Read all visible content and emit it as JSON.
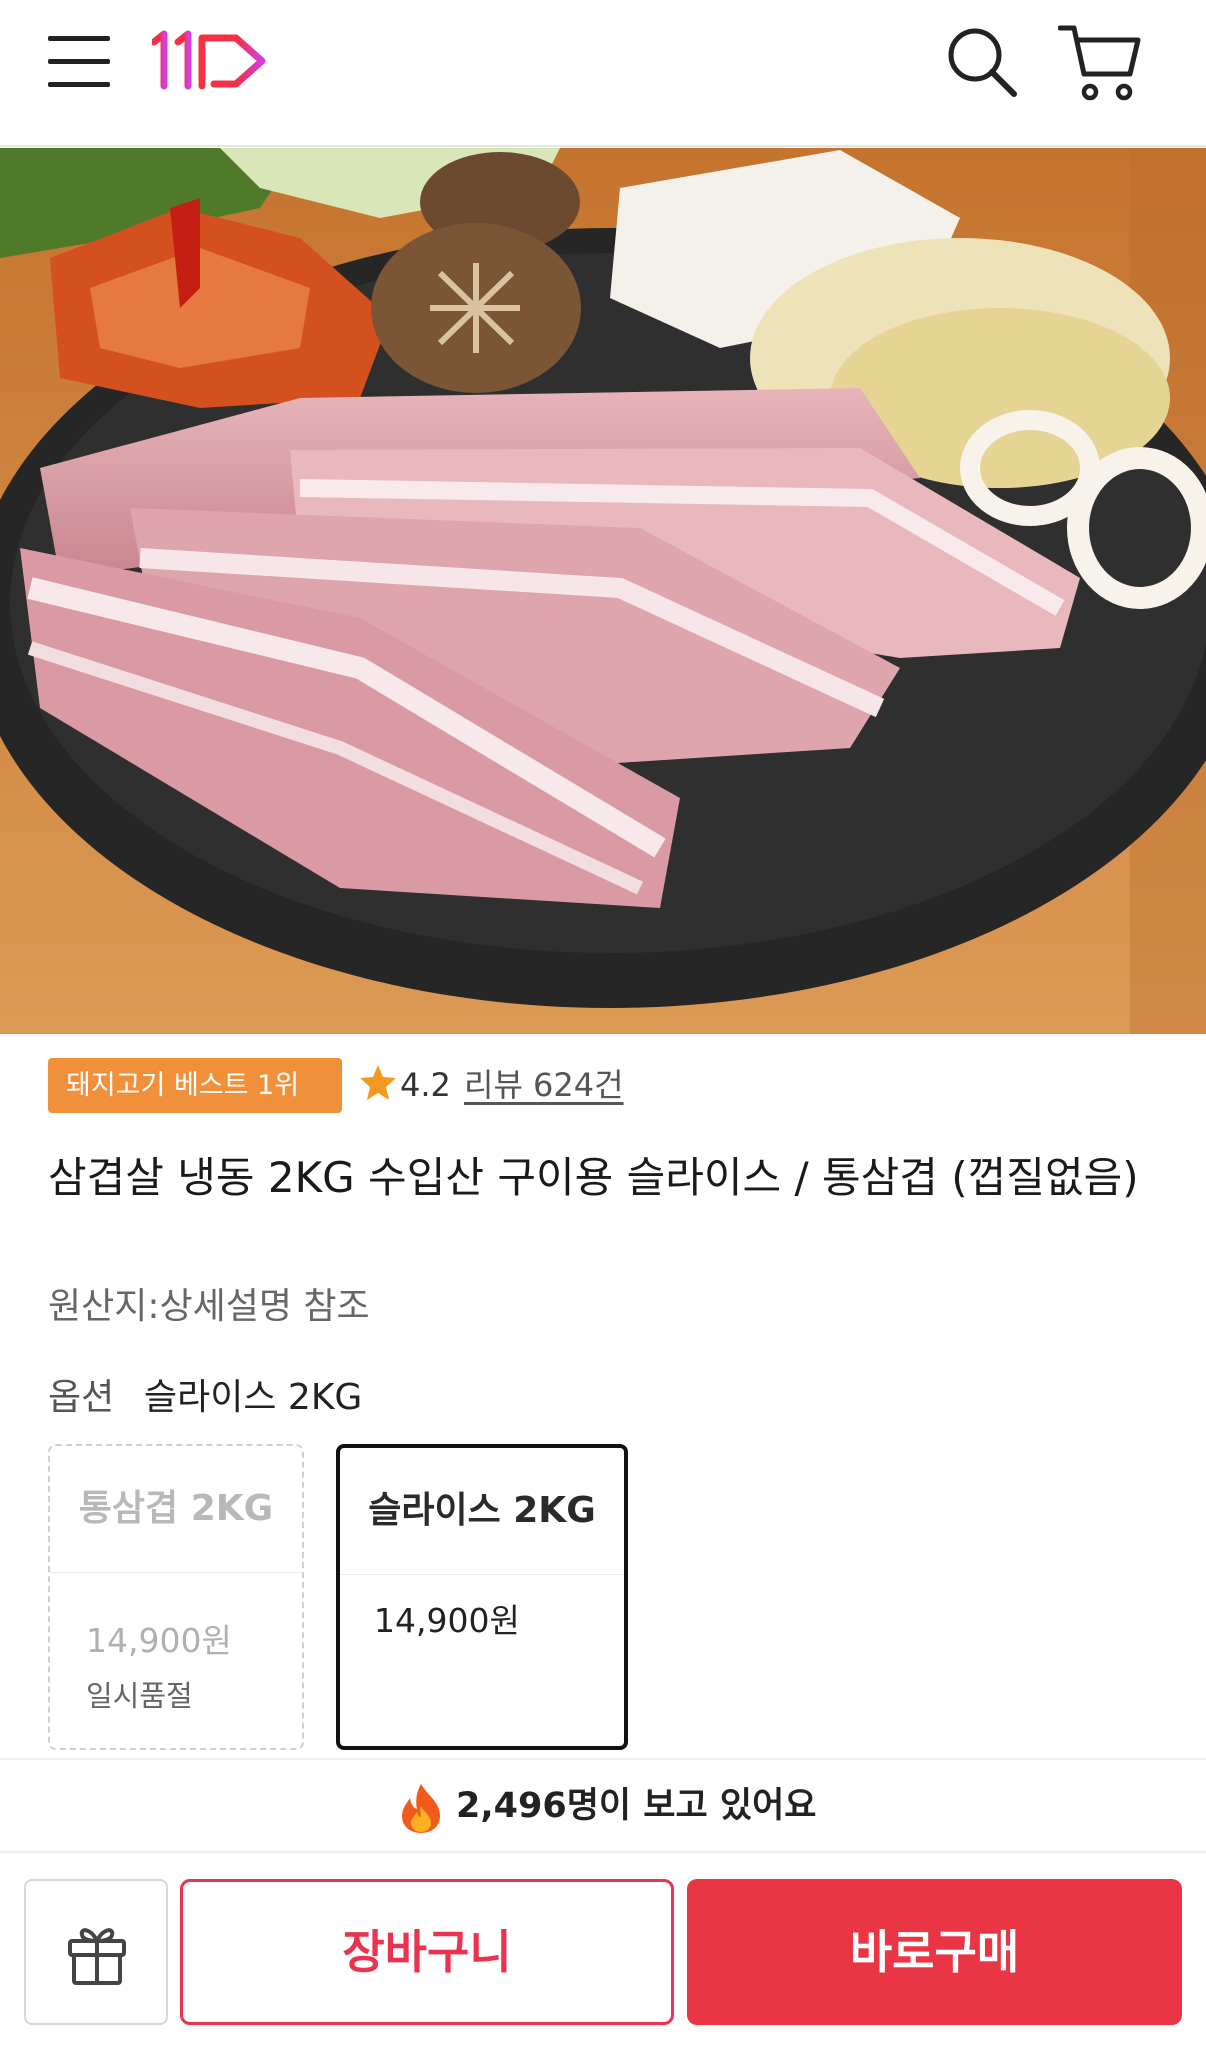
{
  "header": {
    "logo_text": "11",
    "icons": [
      "menu-icon",
      "search-icon",
      "cart-icon"
    ],
    "brand_color": "#e8344e"
  },
  "product": {
    "badge": "돼지고기 베스트 1위",
    "rating": "4.2",
    "reviews": "리뷰 624건",
    "title": "삼겹살 냉동 2KG 수입산 구이용 슬라이스 / 통삼겹 (껍질없음)",
    "origin": "원산지:상세설명 참조"
  },
  "options": {
    "label": "옵션",
    "selected_value": "슬라이스 2KG",
    "cards": [
      {
        "name": "통삼겹 2KG",
        "price": "14,900원",
        "status": "일시품절",
        "state": "soldout"
      },
      {
        "name": "슬라이스 2KG",
        "price": "14,900원",
        "status": "",
        "state": "selected"
      }
    ]
  },
  "watching": {
    "text": "2,496명이 보고 있어요"
  },
  "actions": {
    "cart_label": "장바구니",
    "buy_label": "바로구매",
    "accent_color": "#ea3545"
  }
}
